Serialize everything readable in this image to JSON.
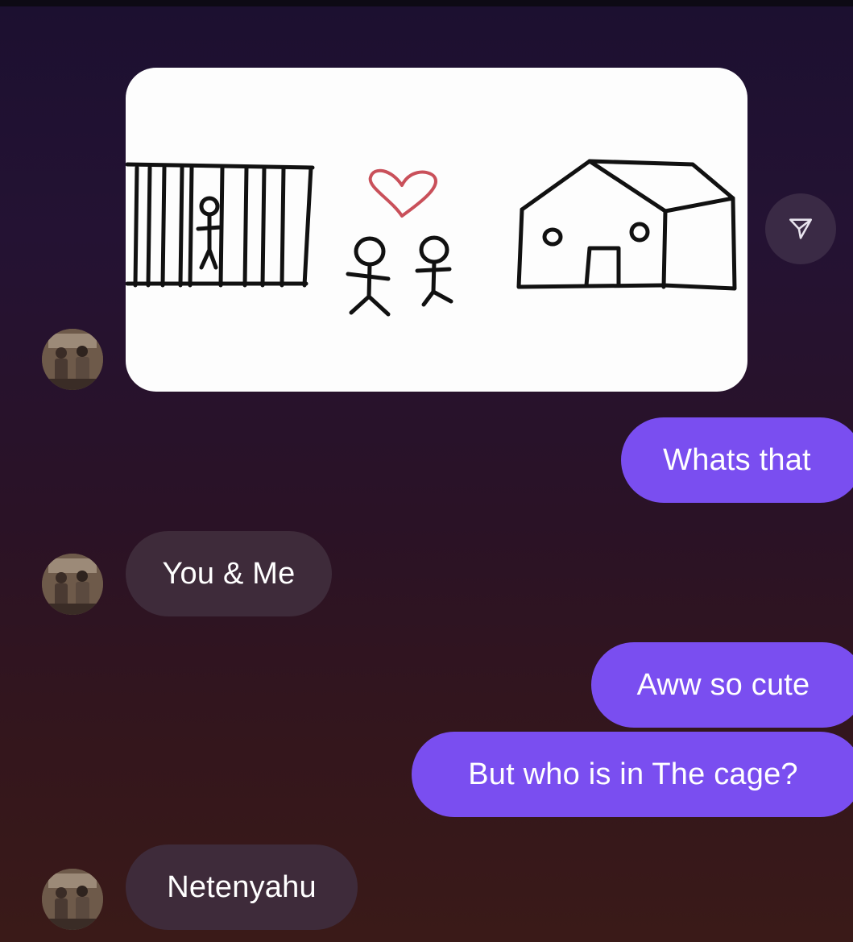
{
  "conversation": {
    "messages": [
      {
        "sender": "them",
        "type": "image",
        "image_alt": ""
      },
      {
        "sender": "me",
        "type": "text",
        "text": "Whats that"
      },
      {
        "sender": "them",
        "type": "text",
        "text": "You & Me"
      },
      {
        "sender": "me",
        "type": "text",
        "text": "Aww so cute"
      },
      {
        "sender": "me",
        "type": "text",
        "text": "But who is in The cage?"
      },
      {
        "sender": "them",
        "type": "text",
        "text": "Netenyahu"
      }
    ]
  },
  "colors": {
    "sent_bubble": "#7a4ef0",
    "received_bubble": "#3e2b3a",
    "heart": "#c9505a"
  },
  "icons": {
    "share": "paper-plane-icon",
    "avatar": "contact-avatar"
  }
}
